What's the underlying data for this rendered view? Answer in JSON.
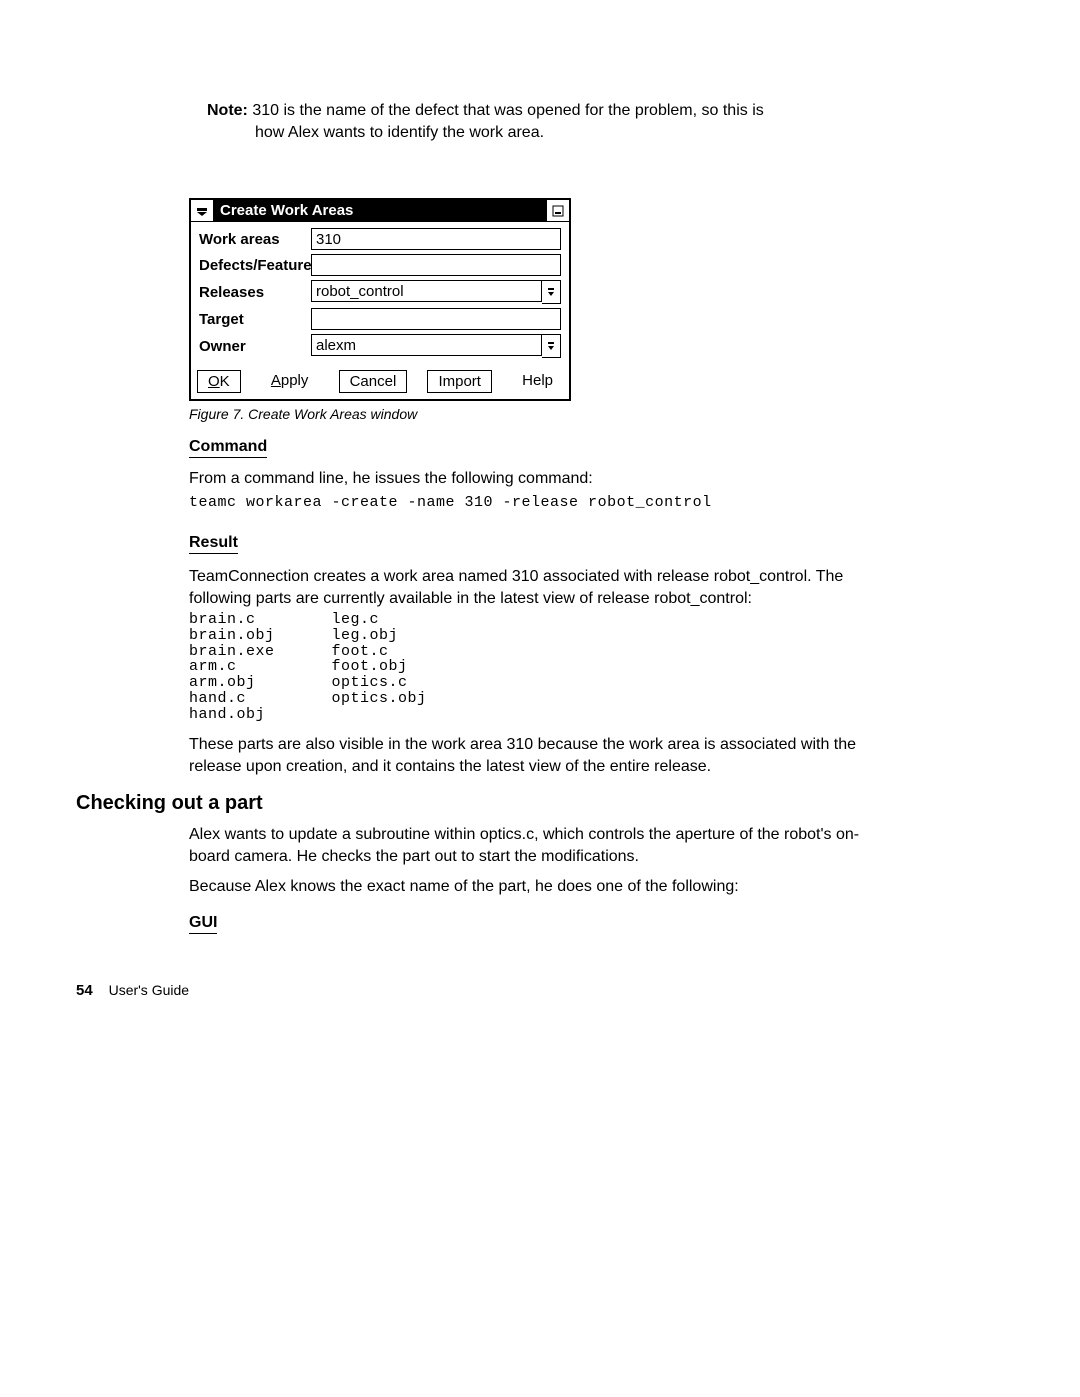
{
  "note": {
    "label": "Note:",
    "line1": "310 is the name of the defect that was opened for the problem, so this is",
    "line2": "how Alex wants to identify the work area."
  },
  "dialog": {
    "title": "Create Work Areas",
    "fields": {
      "work_areas": {
        "label": "Work areas",
        "value": "310"
      },
      "defects_features": {
        "label": "Defects/Features",
        "value": ""
      },
      "releases": {
        "label": "Releases",
        "value": "robot_control"
      },
      "target": {
        "label": "Target",
        "value": ""
      },
      "owner": {
        "label": "Owner",
        "value": "alexm"
      }
    },
    "buttons": {
      "ok_u": "O",
      "ok_rest": "K",
      "apply_u": "A",
      "apply_rest": "pply",
      "cancel": "Cancel",
      "import": "Import",
      "help": "Help"
    }
  },
  "figure_caption": "Figure 7. Create Work Areas window",
  "headings": {
    "command": "Command",
    "result": "Result",
    "gui": "GUI"
  },
  "command": {
    "intro": "From a command line, he issues the following command:",
    "code": "teamc workarea -create -name 310 -release robot_control"
  },
  "result": {
    "p1": "TeamConnection creates a work area named 310 associated with release robot_control. The following parts are currently available in the latest view of release robot_control:",
    "parts_col1": [
      "brain.c",
      "brain.obj",
      "brain.exe",
      "arm.c",
      "arm.obj",
      "hand.c",
      "hand.obj"
    ],
    "parts_col2": [
      "leg.c",
      "leg.obj",
      "foot.c",
      "foot.obj",
      "optics.c",
      "optics.obj"
    ],
    "p2": "These parts are also visible in the work area 310 because the work area is associated with the release upon creation, and it contains the latest view of the entire release."
  },
  "h2": "Checking out a part",
  "checking": {
    "p1": "Alex wants to update a subroutine within optics.c, which controls the aperture of the robot's on-board camera. He checks the part out to start the modifications.",
    "p2": "Because Alex knows the exact name of the part, he does one of the following:"
  },
  "footer": {
    "page_number": "54",
    "book_title": "User's Guide"
  }
}
